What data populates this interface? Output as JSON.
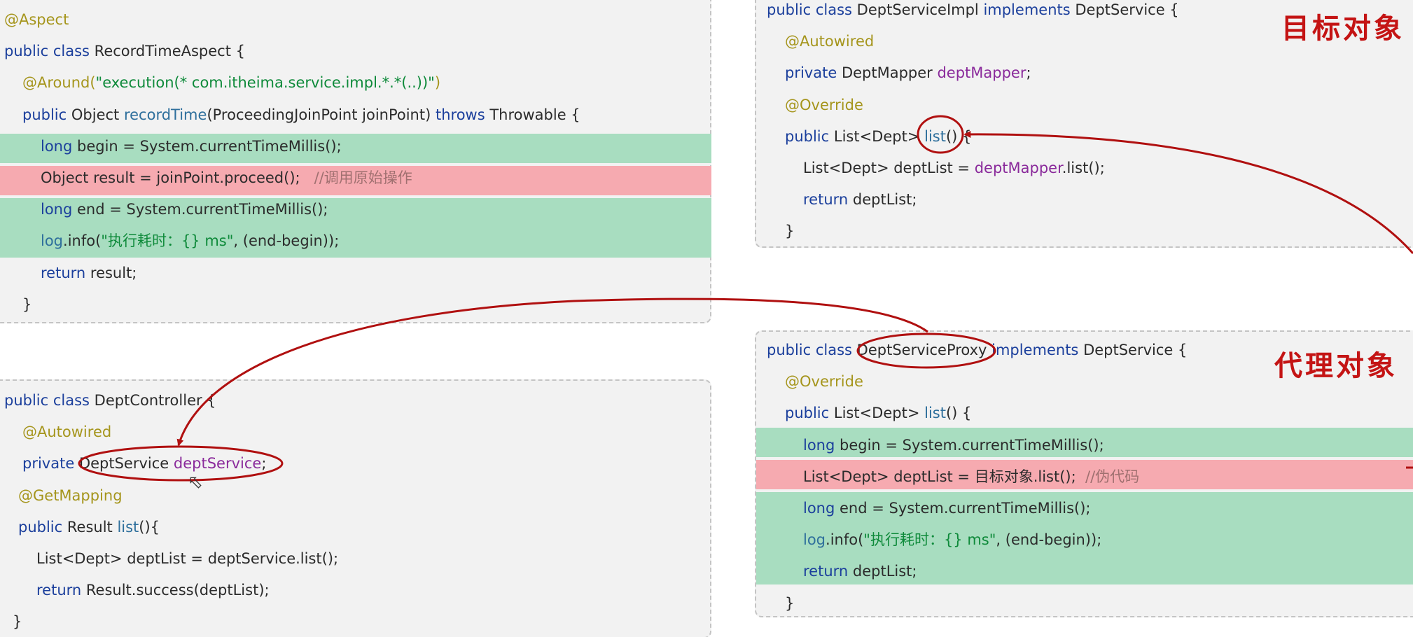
{
  "colors": {
    "keyword": "#1b3f9c",
    "annotation": "#a5951c",
    "string": "#0e8a3a",
    "method": "#2e6f9c",
    "field": "#8a2a9b",
    "comment": "#a07070",
    "text": "#2b2b2b",
    "highlight_green": "#a8ddc0",
    "highlight_red": "#f6aab0",
    "panel_bg": "#f2f2f2",
    "marker_red": "#b01010"
  },
  "labels": {
    "target_object": "目标对象",
    "proxy_object": "代理对象"
  },
  "code_blocks": [
    {
      "id": "aspect",
      "lines": [
        [
          [
            "@Aspect",
            "an"
          ]
        ],
        [
          [
            "public class ",
            "kw"
          ],
          [
            "RecordTimeAspect {",
            "txt"
          ]
        ],
        [
          [
            "@Around(",
            "an"
          ],
          [
            "\"execution(* com.itheima.service.impl.*.*(..))\"",
            "str"
          ],
          [
            ")",
            "an"
          ]
        ],
        [
          [
            "public ",
            "kw"
          ],
          [
            "Object ",
            "txt"
          ],
          [
            "recordTime",
            "mth"
          ],
          [
            "(ProceedingJoinPoint joinPoint) ",
            "txt"
          ],
          [
            "throws ",
            "kw"
          ],
          [
            "Throwable {",
            "txt"
          ]
        ],
        [
          [
            "long ",
            "kw"
          ],
          [
            "begin = System.currentTimeMillis();",
            "txt"
          ]
        ],
        [
          [
            "Object result = joinPoint.proceed();   ",
            "txt"
          ],
          [
            "//调用原始操作",
            "cmt"
          ]
        ],
        [
          [
            "long ",
            "kw"
          ],
          [
            "end = System.currentTimeMillis();",
            "txt"
          ]
        ],
        [
          [
            "log",
            "mth"
          ],
          [
            ".info(",
            "txt"
          ],
          [
            "\"执行耗时：{} ms\"",
            "str"
          ],
          [
            ", (end-begin));",
            "txt"
          ]
        ],
        [
          [
            "return ",
            "kw"
          ],
          [
            "result;",
            "txt"
          ]
        ],
        [
          [
            "}",
            "txt"
          ]
        ]
      ]
    },
    {
      "id": "impl",
      "lines": [
        [
          [
            "public class ",
            "kw"
          ],
          [
            "DeptServiceImpl ",
            "txt"
          ],
          [
            "implements ",
            "kw"
          ],
          [
            "DeptService {",
            "txt"
          ]
        ],
        [
          [
            "@Autowired",
            "an"
          ]
        ],
        [
          [
            "private ",
            "kw"
          ],
          [
            "DeptMapper ",
            "txt"
          ],
          [
            "deptMapper",
            "fld"
          ],
          [
            ";",
            "txt"
          ]
        ],
        [
          [
            "@Override",
            "an"
          ]
        ],
        [
          [
            "public ",
            "kw"
          ],
          [
            "List<Dept> ",
            "txt"
          ],
          [
            "list",
            "mth"
          ],
          [
            "() {",
            "txt"
          ]
        ],
        [
          [
            "List<Dept> deptList = ",
            "txt"
          ],
          [
            "deptMapper",
            "fld"
          ],
          [
            ".list();",
            "txt"
          ]
        ],
        [
          [
            "return ",
            "kw"
          ],
          [
            "deptList;",
            "txt"
          ]
        ],
        [
          [
            "}",
            "txt"
          ]
        ]
      ]
    },
    {
      "id": "ctrl",
      "lines": [
        [
          [
            "public class ",
            "kw"
          ],
          [
            "DeptController {",
            "txt"
          ]
        ],
        [
          [
            "@Autowired",
            "an"
          ]
        ],
        [
          [
            "private ",
            "kw"
          ],
          [
            "DeptService ",
            "txt"
          ],
          [
            "deptService",
            "fld"
          ],
          [
            ";",
            "txt"
          ]
        ],
        [
          [
            "@GetMapping",
            "an"
          ]
        ],
        [
          [
            "public ",
            "kw"
          ],
          [
            "Result ",
            "txt"
          ],
          [
            "list",
            "mth"
          ],
          [
            "(){",
            "txt"
          ]
        ],
        [
          [
            "List<Dept> deptList = deptService.list();",
            "txt"
          ]
        ],
        [
          [
            "return ",
            "kw"
          ],
          [
            "Result.success(deptList);",
            "txt"
          ]
        ],
        [
          [
            "}",
            "txt"
          ]
        ]
      ]
    },
    {
      "id": "proxy",
      "lines": [
        [
          [
            "public class ",
            "kw"
          ],
          [
            "DeptServiceProxy ",
            "txt"
          ],
          [
            "implements ",
            "kw"
          ],
          [
            "DeptService {",
            "txt"
          ]
        ],
        [
          [
            "@Override",
            "an"
          ]
        ],
        [
          [
            "public ",
            "kw"
          ],
          [
            "List<Dept> ",
            "txt"
          ],
          [
            "list",
            "mth"
          ],
          [
            "() {",
            "txt"
          ]
        ],
        [
          [
            "long ",
            "kw"
          ],
          [
            "begin = System.currentTimeMillis();",
            "txt"
          ]
        ],
        [
          [
            "List<Dept> deptList = 目标对象.list();  ",
            "txt"
          ],
          [
            "//伪代码",
            "cmt"
          ]
        ],
        [
          [
            "long ",
            "kw"
          ],
          [
            "end = System.currentTimeMillis();",
            "txt"
          ]
        ],
        [
          [
            "log",
            "mth"
          ],
          [
            ".info(",
            "txt"
          ],
          [
            "\"执行耗时：{} ms\"",
            "str"
          ],
          [
            ", (end-begin));",
            "txt"
          ]
        ],
        [
          [
            "return ",
            "kw"
          ],
          [
            "deptList;",
            "txt"
          ]
        ],
        [
          [
            "}",
            "txt"
          ]
        ]
      ]
    }
  ]
}
